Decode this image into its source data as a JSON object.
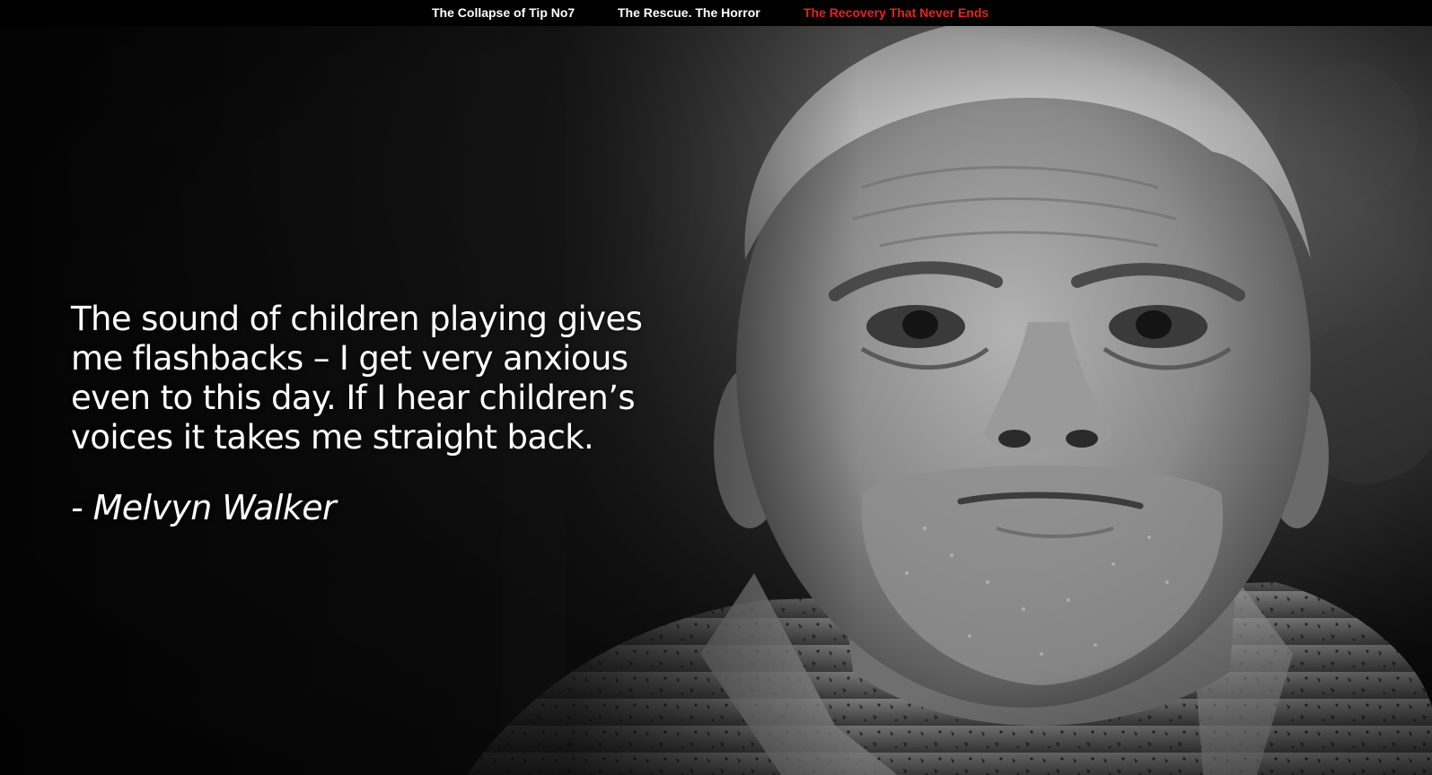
{
  "nav": {
    "items": [
      {
        "label": "The Collapse of Tip No7",
        "color": "#ffffff"
      },
      {
        "label": "The Rescue. The Horror",
        "color": "#ffffff"
      },
      {
        "label": "The Recovery That Never Ends",
        "color": "#e8231f"
      }
    ],
    "background": "#000000"
  },
  "hero": {
    "image_description_icon": "portrait-photo",
    "quote": "The sound of children playing gives me flashbacks – I get very anxious even to this day. If I hear children’s voices it takes me straight back.",
    "attribution": "- Melvyn Walker"
  }
}
